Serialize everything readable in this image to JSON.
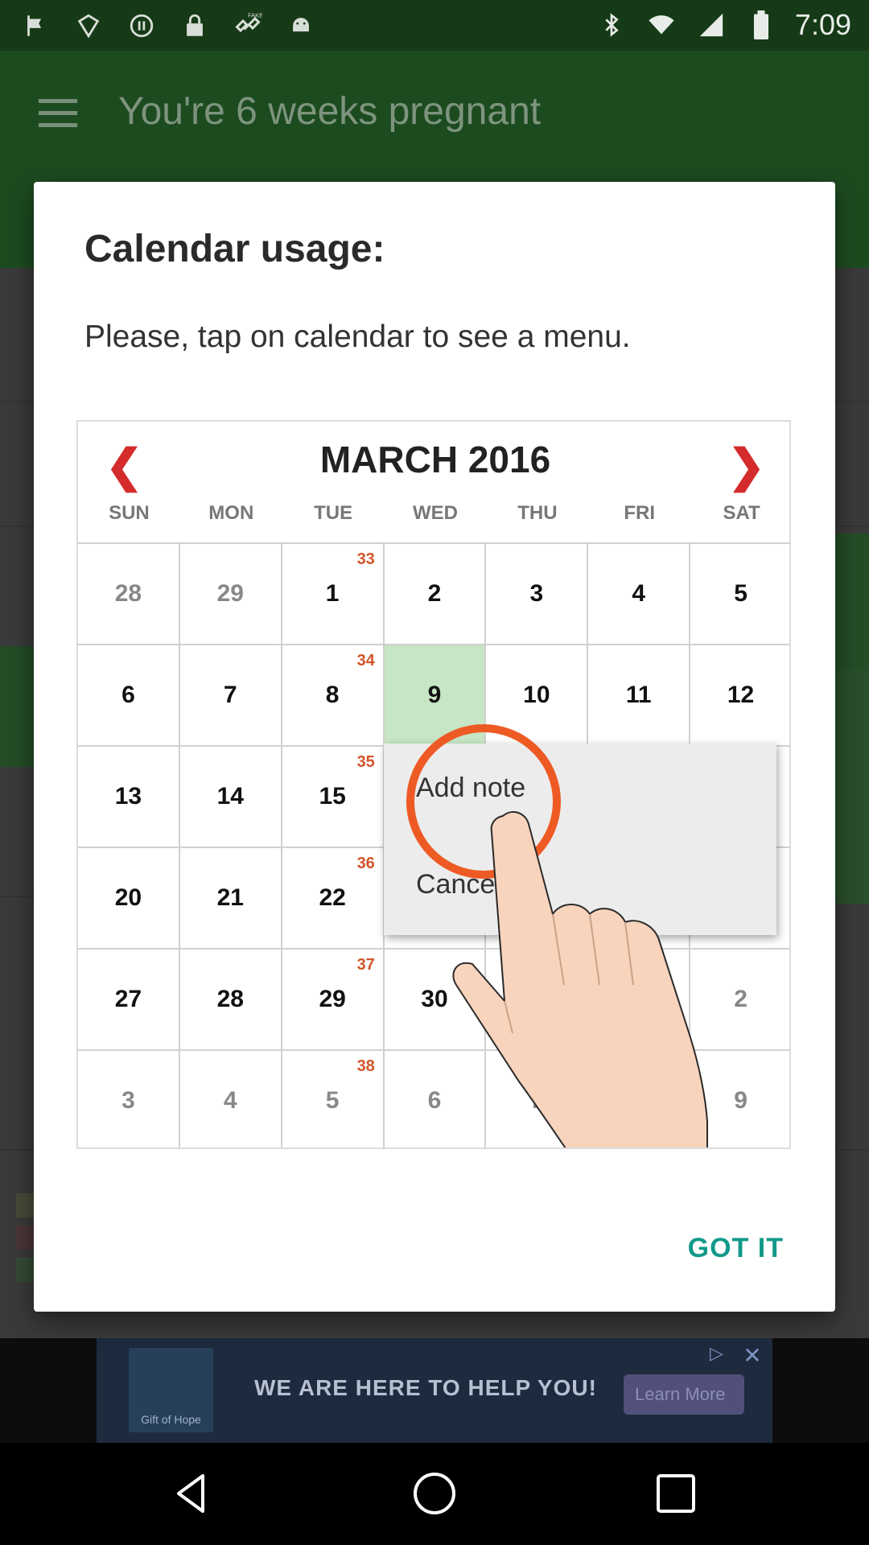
{
  "status_bar": {
    "time": "7:09",
    "left_icons": [
      "flag-icon",
      "image-icon",
      "circle-icon",
      "lock-icon",
      "fake-gps-icon",
      "android-icon"
    ],
    "right_icons": [
      "bluetooth-icon",
      "wifi-icon",
      "signal-icon",
      "battery-icon"
    ]
  },
  "app_bar": {
    "title": "You're 6 weeks pregnant"
  },
  "dialog": {
    "title": "Calendar usage:",
    "message": "Please, tap on calendar to see a menu.",
    "button": "GOT IT"
  },
  "illustration": {
    "month": "MARCH 2016",
    "weekdays": [
      "SUN",
      "MON",
      "TUE",
      "WED",
      "THU",
      "FRI",
      "SAT"
    ],
    "weeks": [
      {
        "week": "33",
        "days": [
          "28",
          "29",
          "1",
          "2",
          "3",
          "4",
          "5"
        ],
        "other": [
          0,
          1
        ]
      },
      {
        "week": "34",
        "days": [
          "6",
          "7",
          "8",
          "9",
          "10",
          "11",
          "12"
        ],
        "other": []
      },
      {
        "week": "35",
        "days": [
          "13",
          "14",
          "15",
          "",
          "",
          "",
          ""
        ],
        "other": []
      },
      {
        "week": "36",
        "days": [
          "20",
          "21",
          "22",
          "",
          "",
          "",
          ""
        ],
        "other": []
      },
      {
        "week": "37",
        "days": [
          "27",
          "28",
          "29",
          "30",
          "",
          "",
          "2"
        ],
        "other": [
          6
        ]
      },
      {
        "week": "38",
        "days": [
          "3",
          "4",
          "5",
          "6",
          "7",
          "",
          "9"
        ],
        "other": [
          0,
          1,
          2,
          3,
          4,
          6
        ]
      }
    ],
    "selected_day": "9",
    "popup_options": [
      "Add note",
      "Cancel"
    ]
  },
  "ad": {
    "logo_text": "Gift of Hope",
    "text": "WE ARE HERE TO HELP YOU!",
    "cta": "Learn More"
  },
  "colors": {
    "accent": "#11998a",
    "app_bar": "#1d4b20",
    "week_number": "#d2552a",
    "ring": "#ee5a24",
    "selected_day": "#c6e6c5"
  }
}
